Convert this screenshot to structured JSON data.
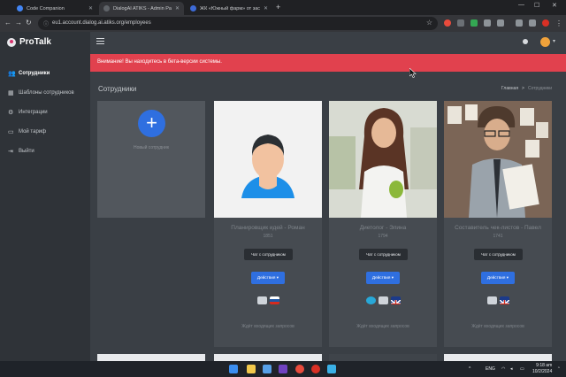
{
  "browser": {
    "tabs": [
      {
        "title": "Code Companion",
        "active": false,
        "color": "#4285f4"
      },
      {
        "title": "DialogAI ATIKS - Admin Panel",
        "active": true,
        "color": "#5f6368"
      },
      {
        "title": "ЖК «Южный фарм» от застро...",
        "active": false,
        "color": "#3d6ad6"
      }
    ],
    "new_tab": "+",
    "url": "eu1.account.dialog.ai.atiks.org/employees",
    "win_minimize": "—",
    "win_maximize": "☐",
    "win_close": "✕"
  },
  "app": {
    "brand": "ProTalk",
    "sidebar": [
      {
        "icon": "users-icon",
        "glyph": "👥",
        "label": "Сотрудники",
        "active": true
      },
      {
        "icon": "template-icon",
        "glyph": "▦",
        "label": "Шаблоны сотрудников",
        "active": false
      },
      {
        "icon": "integrations-icon",
        "glyph": "⚙",
        "label": "Интеграции",
        "active": false
      },
      {
        "icon": "tariff-icon",
        "glyph": "▭",
        "label": "Мой тариф",
        "active": false
      },
      {
        "icon": "logout-icon",
        "glyph": "⇥",
        "label": "Выйти",
        "active": false
      }
    ],
    "alert": "Внимание! Вы находитесь в бета-версии системы.",
    "page_title": "Сотрудники",
    "breadcrumb": {
      "home": "Главная",
      "separator": ">",
      "current": "Сотрудники"
    },
    "new_employee": {
      "plus": "+",
      "label": "Новый сотрудник"
    },
    "employees": [
      {
        "name": "Планировщик идей - Роман",
        "id": "1851",
        "chat": "Чат с сотрудником",
        "actions": "Действия ▾",
        "link": "Ждёт входящих запросов"
      },
      {
        "name": "Диетолог - Элина",
        "id": "1794",
        "chat": "Чат с сотрудником",
        "actions": "Действия ▾",
        "link": "Ждёт входящих запросов"
      },
      {
        "name": "Составитель чек-листов - Павел",
        "id": "1741",
        "chat": "Чат с сотрудником",
        "actions": "Действия ▾",
        "link": "Ждёт входящих запросов"
      }
    ],
    "accent": "#2f6fe0",
    "alert_color": "#e1414e"
  },
  "taskbar": {
    "lang": "ENG",
    "time": "9:18 am",
    "date": "10/2/2024"
  }
}
